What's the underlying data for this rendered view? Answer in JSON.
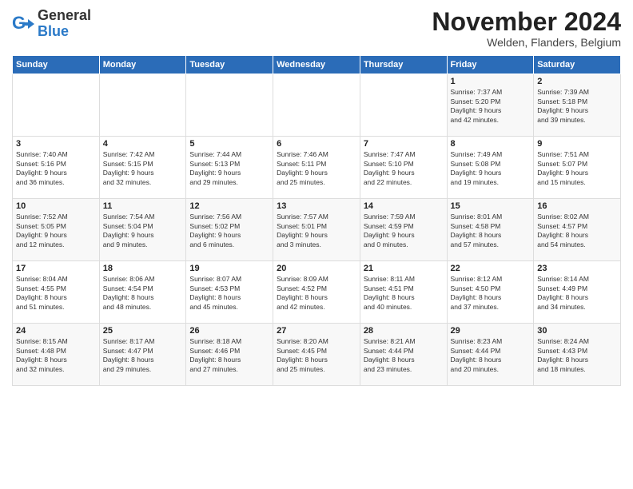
{
  "logo": {
    "general": "General",
    "blue": "Blue"
  },
  "title": "November 2024",
  "subtitle": "Welden, Flanders, Belgium",
  "days_of_week": [
    "Sunday",
    "Monday",
    "Tuesday",
    "Wednesday",
    "Thursday",
    "Friday",
    "Saturday"
  ],
  "weeks": [
    [
      {
        "day": "",
        "info": ""
      },
      {
        "day": "",
        "info": ""
      },
      {
        "day": "",
        "info": ""
      },
      {
        "day": "",
        "info": ""
      },
      {
        "day": "",
        "info": ""
      },
      {
        "day": "1",
        "info": "Sunrise: 7:37 AM\nSunset: 5:20 PM\nDaylight: 9 hours\nand 42 minutes."
      },
      {
        "day": "2",
        "info": "Sunrise: 7:39 AM\nSunset: 5:18 PM\nDaylight: 9 hours\nand 39 minutes."
      }
    ],
    [
      {
        "day": "3",
        "info": "Sunrise: 7:40 AM\nSunset: 5:16 PM\nDaylight: 9 hours\nand 36 minutes."
      },
      {
        "day": "4",
        "info": "Sunrise: 7:42 AM\nSunset: 5:15 PM\nDaylight: 9 hours\nand 32 minutes."
      },
      {
        "day": "5",
        "info": "Sunrise: 7:44 AM\nSunset: 5:13 PM\nDaylight: 9 hours\nand 29 minutes."
      },
      {
        "day": "6",
        "info": "Sunrise: 7:46 AM\nSunset: 5:11 PM\nDaylight: 9 hours\nand 25 minutes."
      },
      {
        "day": "7",
        "info": "Sunrise: 7:47 AM\nSunset: 5:10 PM\nDaylight: 9 hours\nand 22 minutes."
      },
      {
        "day": "8",
        "info": "Sunrise: 7:49 AM\nSunset: 5:08 PM\nDaylight: 9 hours\nand 19 minutes."
      },
      {
        "day": "9",
        "info": "Sunrise: 7:51 AM\nSunset: 5:07 PM\nDaylight: 9 hours\nand 15 minutes."
      }
    ],
    [
      {
        "day": "10",
        "info": "Sunrise: 7:52 AM\nSunset: 5:05 PM\nDaylight: 9 hours\nand 12 minutes."
      },
      {
        "day": "11",
        "info": "Sunrise: 7:54 AM\nSunset: 5:04 PM\nDaylight: 9 hours\nand 9 minutes."
      },
      {
        "day": "12",
        "info": "Sunrise: 7:56 AM\nSunset: 5:02 PM\nDaylight: 9 hours\nand 6 minutes."
      },
      {
        "day": "13",
        "info": "Sunrise: 7:57 AM\nSunset: 5:01 PM\nDaylight: 9 hours\nand 3 minutes."
      },
      {
        "day": "14",
        "info": "Sunrise: 7:59 AM\nSunset: 4:59 PM\nDaylight: 9 hours\nand 0 minutes."
      },
      {
        "day": "15",
        "info": "Sunrise: 8:01 AM\nSunset: 4:58 PM\nDaylight: 8 hours\nand 57 minutes."
      },
      {
        "day": "16",
        "info": "Sunrise: 8:02 AM\nSunset: 4:57 PM\nDaylight: 8 hours\nand 54 minutes."
      }
    ],
    [
      {
        "day": "17",
        "info": "Sunrise: 8:04 AM\nSunset: 4:55 PM\nDaylight: 8 hours\nand 51 minutes."
      },
      {
        "day": "18",
        "info": "Sunrise: 8:06 AM\nSunset: 4:54 PM\nDaylight: 8 hours\nand 48 minutes."
      },
      {
        "day": "19",
        "info": "Sunrise: 8:07 AM\nSunset: 4:53 PM\nDaylight: 8 hours\nand 45 minutes."
      },
      {
        "day": "20",
        "info": "Sunrise: 8:09 AM\nSunset: 4:52 PM\nDaylight: 8 hours\nand 42 minutes."
      },
      {
        "day": "21",
        "info": "Sunrise: 8:11 AM\nSunset: 4:51 PM\nDaylight: 8 hours\nand 40 minutes."
      },
      {
        "day": "22",
        "info": "Sunrise: 8:12 AM\nSunset: 4:50 PM\nDaylight: 8 hours\nand 37 minutes."
      },
      {
        "day": "23",
        "info": "Sunrise: 8:14 AM\nSunset: 4:49 PM\nDaylight: 8 hours\nand 34 minutes."
      }
    ],
    [
      {
        "day": "24",
        "info": "Sunrise: 8:15 AM\nSunset: 4:48 PM\nDaylight: 8 hours\nand 32 minutes."
      },
      {
        "day": "25",
        "info": "Sunrise: 8:17 AM\nSunset: 4:47 PM\nDaylight: 8 hours\nand 29 minutes."
      },
      {
        "day": "26",
        "info": "Sunrise: 8:18 AM\nSunset: 4:46 PM\nDaylight: 8 hours\nand 27 minutes."
      },
      {
        "day": "27",
        "info": "Sunrise: 8:20 AM\nSunset: 4:45 PM\nDaylight: 8 hours\nand 25 minutes."
      },
      {
        "day": "28",
        "info": "Sunrise: 8:21 AM\nSunset: 4:44 PM\nDaylight: 8 hours\nand 23 minutes."
      },
      {
        "day": "29",
        "info": "Sunrise: 8:23 AM\nSunset: 4:44 PM\nDaylight: 8 hours\nand 20 minutes."
      },
      {
        "day": "30",
        "info": "Sunrise: 8:24 AM\nSunset: 4:43 PM\nDaylight: 8 hours\nand 18 minutes."
      }
    ]
  ]
}
